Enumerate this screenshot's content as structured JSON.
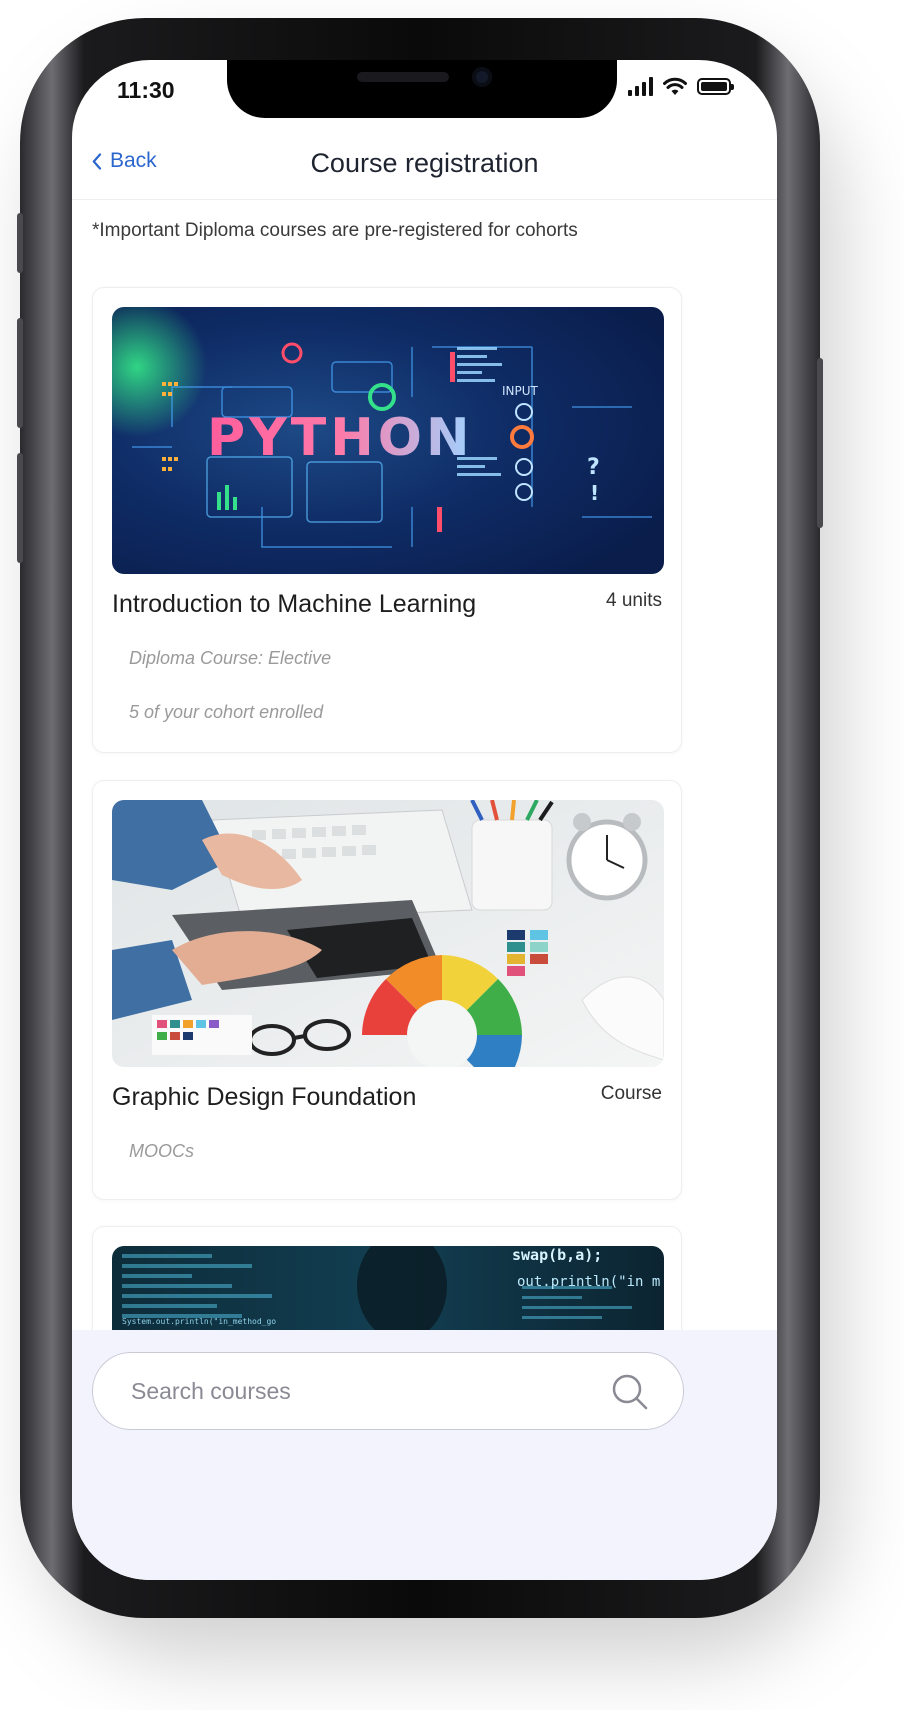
{
  "status_bar": {
    "time": "11:30"
  },
  "nav": {
    "back_label": "Back",
    "title": "Course registration"
  },
  "notice": "*Important Diploma courses are pre-registered for cohorts",
  "courses": [
    {
      "title": "Introduction to Machine Learning",
      "meta": "4 units",
      "details": [
        "Diploma Course: Elective",
        "5 of your cohort enrolled"
      ],
      "image": {
        "word": "PYTHON",
        "tag": "INPUT"
      }
    },
    {
      "title": "Graphic Design Foundation",
      "meta": "Course",
      "details": [
        "MOOCs"
      ]
    },
    {
      "code_lines": [
        "swap(b,a);",
        "out.println(\"in m",
        "System.out.println(\"in_method_go"
      ]
    }
  ],
  "search": {
    "placeholder": "Search courses"
  },
  "colors": {
    "accent": "#2b66ce",
    "panel": "#f3f3fd",
    "text": "#1f2431"
  }
}
